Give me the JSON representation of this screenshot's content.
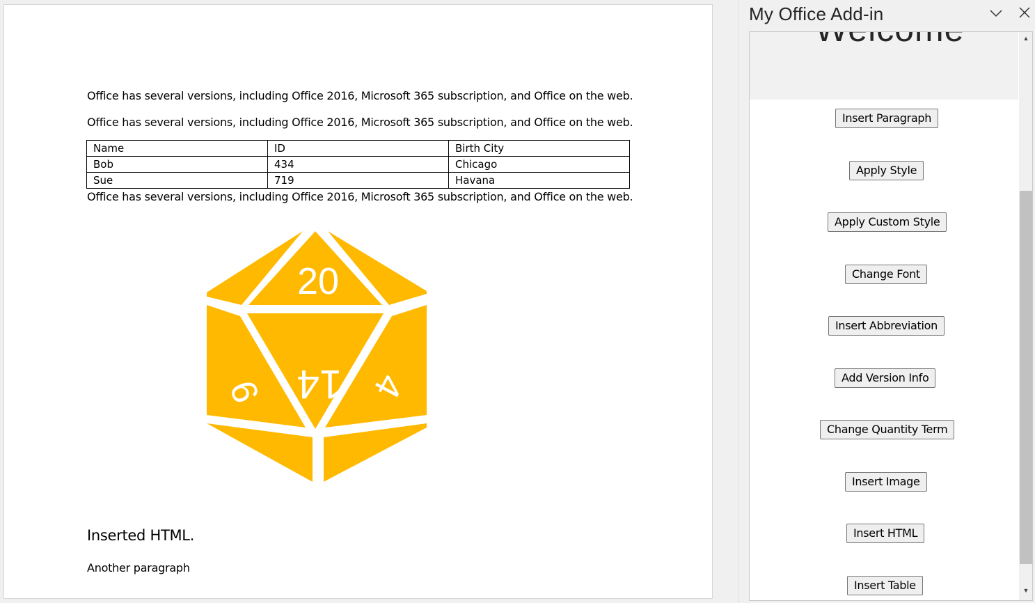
{
  "document": {
    "paragraphs": [
      "Office has several versions, including Office 2016, Microsoft 365 subscription, and Office on the web.",
      "Office has several versions, including Office 2016, Microsoft 365 subscription, and Office on the web.",
      "Office has several versions, including Office 2016, Microsoft 365 subscription, and Office on the web."
    ],
    "table": {
      "rows": [
        [
          "Name",
          "ID",
          "Birth City"
        ],
        [
          "Bob",
          "434",
          "Chicago"
        ],
        [
          "Sue",
          "719",
          "Havana"
        ]
      ]
    },
    "image": {
      "die_numbers": [
        "20",
        "14",
        "9",
        "4"
      ],
      "color": "#FFB900"
    },
    "heading": "Inserted HTML.",
    "last_paragraph": "Another paragraph"
  },
  "task_pane": {
    "title": "My Office Add-in",
    "welcome": "Welcome",
    "buttons": [
      "Insert Paragraph",
      "Apply Style",
      "Apply Custom Style",
      "Change Font",
      "Insert Abbreviation",
      "Add Version Info",
      "Change Quantity Term",
      "Insert Image",
      "Insert HTML",
      "Insert Table"
    ]
  }
}
